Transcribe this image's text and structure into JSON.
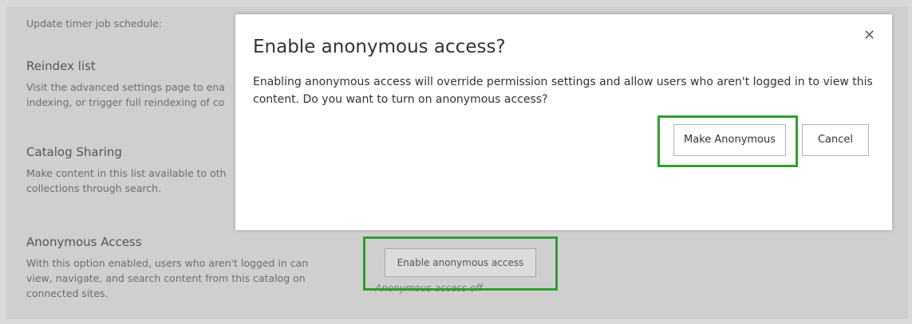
{
  "settings": {
    "timer_label": "Update timer job schedule:",
    "reindex": {
      "title": "Reindex list",
      "description": "Visit the advanced settings page to ena indexing, or trigger full reindexing of co"
    },
    "catalog": {
      "title": "Catalog Sharing",
      "description": "Make content in this list available to oth collections through search."
    },
    "anonymous": {
      "title": "Anonymous Access",
      "description": "With this option enabled, users who aren't logged in can view, navigate, and search content from this catalog on connected sites.",
      "button_label": "Enable anonymous access",
      "status": "Anonymous access off"
    }
  },
  "dialog": {
    "title": "Enable anonymous access?",
    "close_icon": "close-icon",
    "body": "Enabling anonymous access will override permission settings and allow users who aren't logged in to view this content. Do you want to turn on anonymous access?",
    "primary_label": "Make Anonymous",
    "cancel_label": "Cancel"
  },
  "colors": {
    "highlight": "#2f9e2f",
    "overlay": "#cfcfcf"
  }
}
